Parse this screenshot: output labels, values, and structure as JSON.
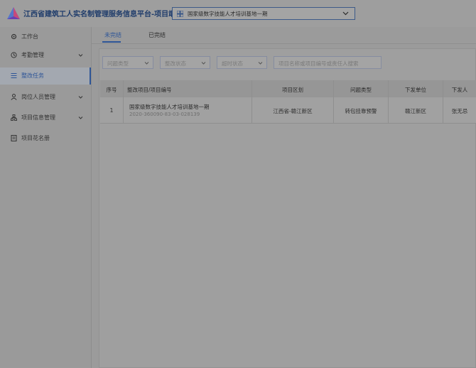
{
  "header": {
    "app_title": "江西省建筑工人实名制管理服务信息平台-项目端",
    "project_select": {
      "value": "国家级数字技能人才培训基地一期"
    }
  },
  "sidebar": {
    "items": [
      {
        "label": "工作台",
        "icon": "gear-icon",
        "expandable": false
      },
      {
        "label": "考勤管理",
        "icon": "clock-icon",
        "expandable": true
      },
      {
        "label": "整改任务",
        "icon": "list-icon",
        "expandable": false,
        "active": true
      },
      {
        "label": "岗位人员管理",
        "icon": "person-icon",
        "expandable": true
      },
      {
        "label": "项目信息管理",
        "icon": "org-chart-icon",
        "expandable": true
      },
      {
        "label": "项目花名册",
        "icon": "roster-icon",
        "expandable": false
      }
    ]
  },
  "tabs": [
    {
      "label": "未完结",
      "active": true
    },
    {
      "label": "已完结",
      "active": false
    }
  ],
  "filters": {
    "problem_type": "问题类型",
    "rectify_status": "整改状态",
    "timeout_status": "超时状态",
    "search_placeholder": "项目名称或项目编号或责任人搜索"
  },
  "table": {
    "columns": [
      "序号",
      "整改项目/项目编号",
      "项目区划",
      "问题类型",
      "下发单位",
      "下发人"
    ],
    "rows": [
      {
        "index": "1",
        "project_name": "国家级数字技能人才培训基地一期",
        "project_code": "2020-360090-83-03-028139",
        "region": "江西省-赣江新区",
        "problem_type": "转包挂靠预警",
        "issuer_unit": "赣江新区",
        "issuer": "张无忌"
      }
    ]
  },
  "colors": {
    "accent": "#2e5597",
    "logo": [
      "#e23b6a",
      "#4a7ae0",
      "#8a4ad0"
    ]
  }
}
